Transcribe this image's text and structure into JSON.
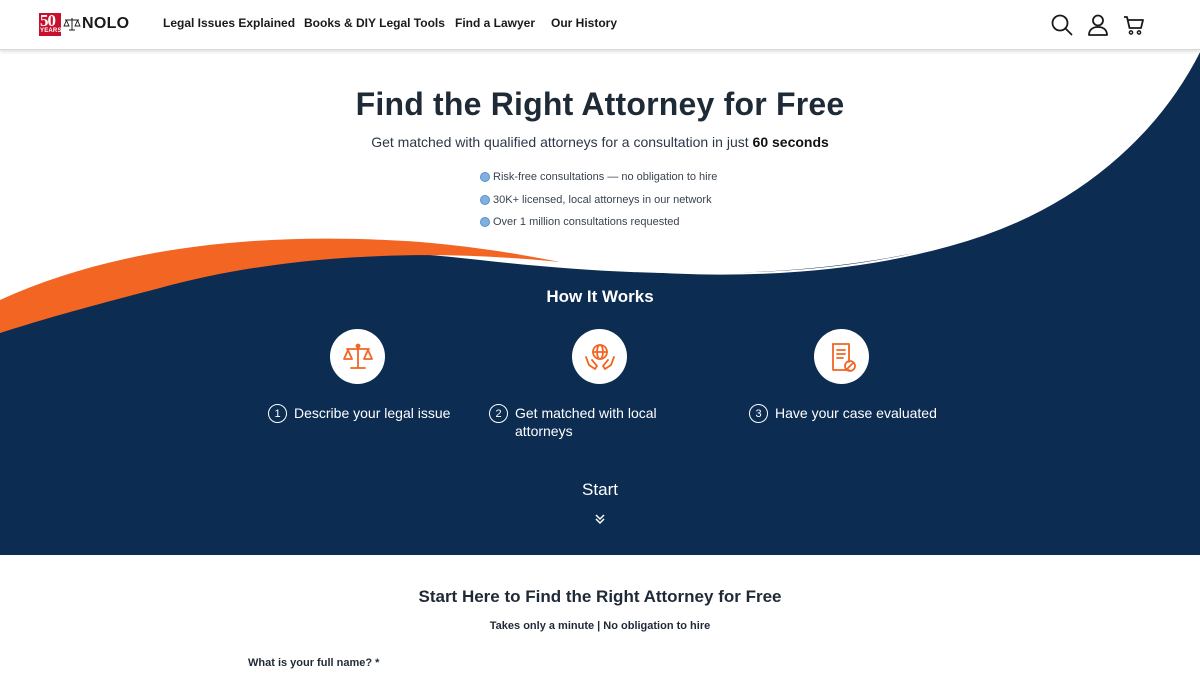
{
  "header": {
    "logo_badge_number": "50",
    "logo_badge_years": "YEARS",
    "logo_text": "NOLO",
    "nav": [
      {
        "label": "Legal Issues Explained"
      },
      {
        "label": "Books & DIY Legal Tools"
      },
      {
        "label": "Find a Lawyer"
      },
      {
        "label": "Our History"
      }
    ],
    "icons": [
      "search-icon",
      "account-icon",
      "cart-icon"
    ]
  },
  "hero": {
    "title": "Find the Right Attorney for Free",
    "subtitle_prefix": "Get matched with qualified attorneys for a consultation in just ",
    "subtitle_bold": "60 seconds",
    "bullets": [
      "Risk-free consultations — no obligation to hire",
      "30K+ licensed, local attorneys in our network",
      "Over 1 million consultations requested"
    ]
  },
  "how_it_works": {
    "title": "How It Works",
    "steps": [
      {
        "number": "1",
        "label": "Describe your legal issue",
        "icon": "scales-icon"
      },
      {
        "number": "2",
        "label": "Get matched with local attorneys",
        "icon": "globe-hands-icon"
      },
      {
        "number": "3",
        "label": "Have your case evaluated",
        "icon": "document-check-icon"
      }
    ],
    "start_label": "Start"
  },
  "form": {
    "title": "Start Here to Find the Right Attorney for Free",
    "subtitle": "Takes only a minute | No obligation to hire",
    "fields": [
      {
        "label": "What is your full name? *"
      }
    ]
  },
  "colors": {
    "navy": "#0c2c52",
    "orange": "#f26522",
    "brand_red": "#c8102e",
    "bullet_dot": "#7fb0e0"
  }
}
